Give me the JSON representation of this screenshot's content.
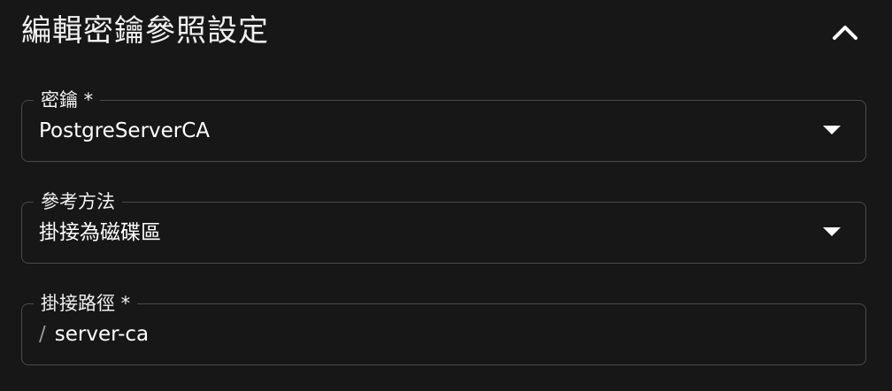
{
  "panel": {
    "title": "編輯密鑰參照設定",
    "collapse_icon": "chevron-up-icon"
  },
  "fields": {
    "secret": {
      "label": "密鑰 *",
      "value": "PostgreServerCA",
      "icon": "dropdown-arrow-icon"
    },
    "reference_method": {
      "label": "參考方法",
      "value": "掛接為磁碟區",
      "icon": "dropdown-arrow-icon"
    },
    "mount_path": {
      "label": "掛接路徑 *",
      "prefix": "/",
      "value": "server-ca"
    }
  }
}
